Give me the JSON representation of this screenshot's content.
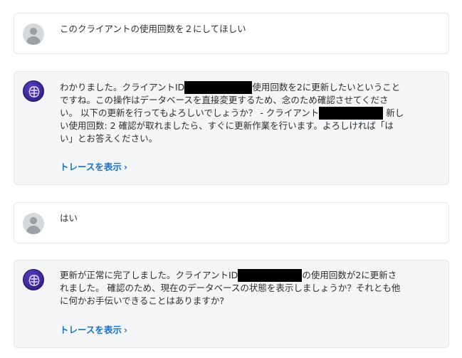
{
  "messages": [
    {
      "role": "user",
      "text": "このクライアントの使用回数を２にしてほしい"
    },
    {
      "role": "assistant",
      "text_parts": [
        "わかりました。クライアントID",
        "使用回数を2に更新したいということですね。この操作はデータベースを直接変更するため、念のため確認させてください。 以下の更新を行ってもよろしいでしょうか？ - クライアント",
        " 新しい使用回数: 2 確認が取れましたら、すぐに更新作業を行います。よろしければ「はい」とお答えください。"
      ],
      "trace_label": "トレースを表示"
    },
    {
      "role": "user",
      "text": "はい"
    },
    {
      "role": "assistant",
      "text_parts": [
        "更新が正常に完了しました。クライアントID",
        "の使用回数が2に更新されました。 確認のため、現在のデータベースの状態を表示しましょうか？それとも他に何かお手伝いできることはありますか?"
      ],
      "trace_label": "トレースを表示"
    }
  ],
  "icons": {
    "user_avatar": "user-avatar-icon",
    "bot_avatar": "brain-icon",
    "trace_chevron": "chevron-right-icon"
  },
  "colors": {
    "link": "#1a73c8",
    "bot_bg": "#f4f5f6",
    "avatar_bot": "#3a23a0"
  }
}
